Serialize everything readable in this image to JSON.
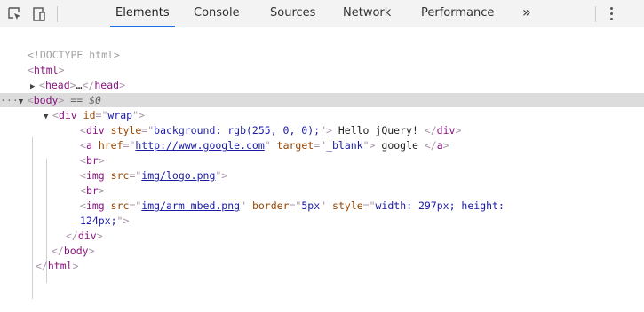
{
  "toolbar": {
    "tabs": [
      {
        "label": "Elements",
        "active": true
      },
      {
        "label": "Console"
      },
      {
        "label": "Sources"
      },
      {
        "label": "Network"
      },
      {
        "label": "Performance"
      }
    ],
    "more": "»",
    "accent": "#1a73e8"
  },
  "dom": {
    "doctype": "<!DOCTYPE html>",
    "html_open": "html",
    "head": {
      "tag": "head",
      "ellipsis": "…"
    },
    "body": {
      "tag": "body",
      "selection": "== $0"
    },
    "wrap": {
      "tag": "div",
      "attr": "id",
      "value": "wrap"
    },
    "div1": {
      "tag": "div",
      "attr": "style",
      "value": "background: rgb(255, 0, 0);",
      "text": " Hello jQuery! "
    },
    "a1": {
      "tag": "a",
      "attr1": "href",
      "value1": "http://www.google.com",
      "attr2": "target",
      "value2": "_blank",
      "text": " google "
    },
    "br": "br",
    "img1": {
      "tag": "img",
      "attr": "src",
      "value": "img/logo.png"
    },
    "img2": {
      "tag": "img",
      "attr1": "src",
      "value1": "img/arm mbed.png",
      "attr2": "border",
      "value2": "5px",
      "attr3": "style",
      "value3a": "width: 297px; height:",
      "value3b": "124px;"
    },
    "div_close": "div",
    "body_close": "body",
    "html_close": "html"
  }
}
